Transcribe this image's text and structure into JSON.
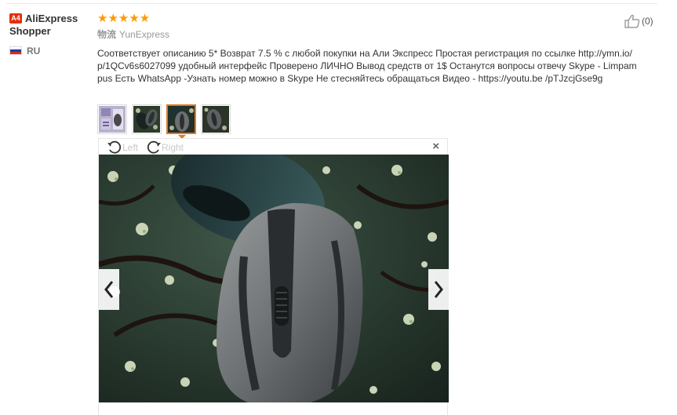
{
  "user": {
    "level_badge": "A4",
    "name": "AliExpress Shopper",
    "country": "RU"
  },
  "review": {
    "stars": "★★★★★",
    "rating": 5,
    "logistics_label": "物流",
    "logistics_company": "YunExpress",
    "text": "Соответствует описанию 5* Возврат 7.5 % с любой покупки на Али Экспресс Простая регистрация по ссылке http://ymn.io/p/1QCv6s6027099 удобный интерфейс Проверено ЛИЧНО Вывод средств от 1$ Останутся вопросы отвечу Skype - Limpampus Есть WhatsApp -Узнать номер можно в Skype Не стесняйтесь обращаться Видео - https://youtu.be /pTJzcjGse9g"
  },
  "helpful": {
    "count": "(0)"
  },
  "thumbnails": [
    {
      "name": "thumb-1",
      "active": false
    },
    {
      "name": "thumb-2",
      "active": false
    },
    {
      "name": "thumb-3",
      "active": true
    },
    {
      "name": "thumb-4",
      "active": false
    }
  ],
  "viewer": {
    "rotate_left_label": "Left",
    "rotate_right_label": "Right",
    "close_label": "×"
  },
  "colors": {
    "star": "#ff9a00",
    "badge": "#e62e04",
    "active_thumb_border": "#e07b22"
  }
}
